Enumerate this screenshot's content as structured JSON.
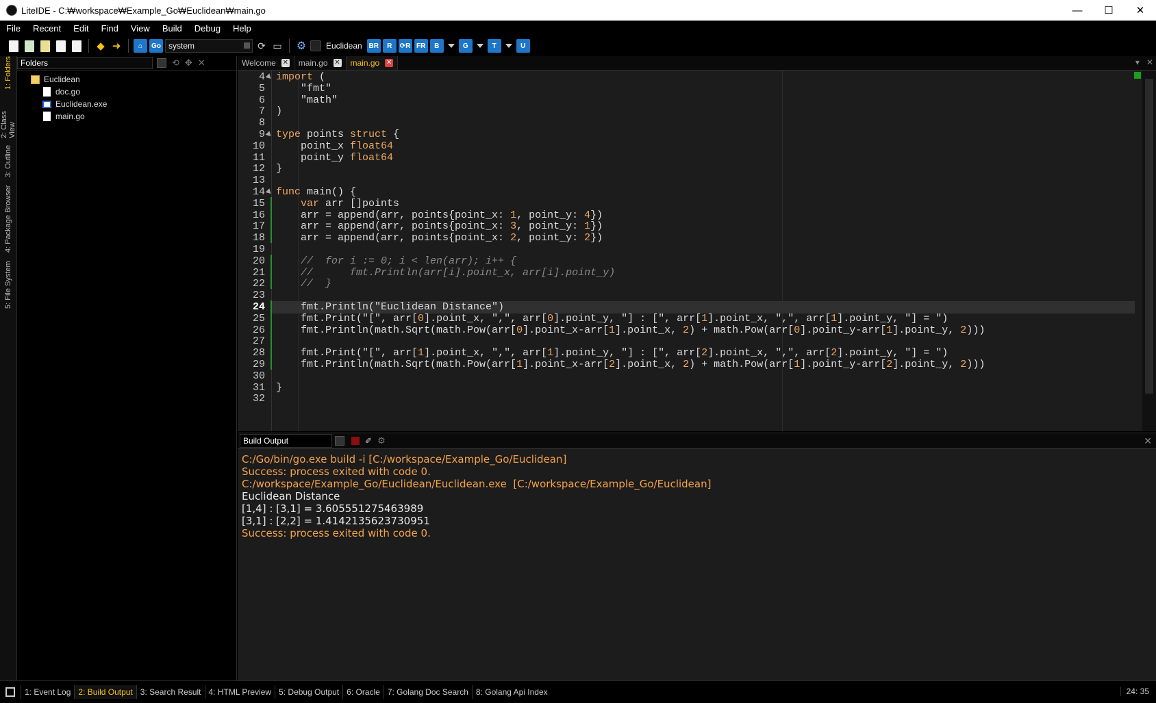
{
  "window": {
    "title": "LiteIDE - C:₩workspace₩Example_Go₩Euclidean₩main.go",
    "minimize": "—",
    "maximize": "☐",
    "close": "✕"
  },
  "menu": [
    "File",
    "Recent",
    "Edit",
    "Find",
    "View",
    "Build",
    "Debug",
    "Help"
  ],
  "toolbar": {
    "environment": "system",
    "project": "Euclidean",
    "build_buttons": [
      "BR",
      "R",
      "⟳R",
      "FR",
      "B",
      "G",
      "T",
      "U"
    ]
  },
  "side_tabs": [
    "1: Folders",
    "2: Class View",
    "3: Outline",
    "4: Package Browser",
    "5: File System"
  ],
  "folders": {
    "title": "Folders",
    "root": "Euclidean",
    "files": [
      {
        "name": "doc.go",
        "type": "file"
      },
      {
        "name": "Euclidean.exe",
        "type": "exe"
      },
      {
        "name": "main.go",
        "type": "file"
      }
    ]
  },
  "editor": {
    "tabs": [
      "Welcome",
      "main.go",
      "main.go"
    ],
    "active_tab": 2,
    "current_line": 24,
    "lines": [
      {
        "n": "4",
        "fold": true,
        "t": "import ("
      },
      {
        "n": "5",
        "t": "    \"fmt\""
      },
      {
        "n": "6",
        "t": "    \"math\""
      },
      {
        "n": "7",
        "t": ")"
      },
      {
        "n": "8",
        "t": ""
      },
      {
        "n": "9",
        "fold": true,
        "t": "type points struct {"
      },
      {
        "n": "10",
        "t": "    point_x float64"
      },
      {
        "n": "11",
        "t": "    point_y float64"
      },
      {
        "n": "12",
        "t": "}"
      },
      {
        "n": "13",
        "t": ""
      },
      {
        "n": "14",
        "fold": true,
        "t": "func main() {"
      },
      {
        "n": "15",
        "t": "    var arr []points"
      },
      {
        "n": "16",
        "t": "    arr = append(arr, points{point_x: 1, point_y: 4})"
      },
      {
        "n": "17",
        "t": "    arr = append(arr, points{point_x: 3, point_y: 1})"
      },
      {
        "n": "18",
        "t": "    arr = append(arr, points{point_x: 2, point_y: 2})"
      },
      {
        "n": "19",
        "t": ""
      },
      {
        "n": "20",
        "t": "    //  for i := 0; i < len(arr); i++ {"
      },
      {
        "n": "21",
        "t": "    //      fmt.Println(arr[i].point_x, arr[i].point_y)"
      },
      {
        "n": "22",
        "t": "    //  }"
      },
      {
        "n": "23",
        "t": ""
      },
      {
        "n": "24",
        "t": "    fmt.Println(\"Euclidean Distance\")"
      },
      {
        "n": "25",
        "t": "    fmt.Print(\"[\", arr[0].point_x, \",\", arr[0].point_y, \"] : [\", arr[1].point_x, \",\", arr[1].point_y, \"] = \")"
      },
      {
        "n": "26",
        "t": "    fmt.Println(math.Sqrt(math.Pow(arr[0].point_x-arr[1].point_x, 2) + math.Pow(arr[0].point_y-arr[1].point_y, 2)))"
      },
      {
        "n": "27",
        "t": ""
      },
      {
        "n": "28",
        "t": "    fmt.Print(\"[\", arr[1].point_x, \",\", arr[1].point_y, \"] : [\", arr[2].point_x, \",\", arr[2].point_y, \"] = \")"
      },
      {
        "n": "29",
        "t": "    fmt.Println(math.Sqrt(math.Pow(arr[1].point_x-arr[2].point_x, 2) + math.Pow(arr[1].point_y-arr[2].point_y, 2)))"
      },
      {
        "n": "30",
        "t": ""
      },
      {
        "n": "31",
        "t": "}"
      },
      {
        "n": "32",
        "t": ""
      }
    ]
  },
  "build_output": {
    "title": "Build Output",
    "lines": [
      {
        "t": "C:/Go/bin/go.exe build -i [C:/workspace/Example_Go/Euclidean]",
        "c": "orange"
      },
      {
        "t": "Success: process exited with code 0.",
        "c": "orange"
      },
      {
        "t": "C:/workspace/Example_Go/Euclidean/Euclidean.exe  [C:/workspace/Example_Go/Euclidean]",
        "c": "orange"
      },
      {
        "t": "Euclidean Distance",
        "c": "white"
      },
      {
        "t": "[1,4] : [3,1] = 3.605551275463989",
        "c": "white"
      },
      {
        "t": "[3,1] : [2,2] = 1.4142135623730951",
        "c": "white"
      },
      {
        "t": "Success: process exited with code 0.",
        "c": "orange"
      }
    ]
  },
  "status_tabs": [
    "1: Event Log",
    "2: Build Output",
    "3: Search Result",
    "4: HTML Preview",
    "5: Debug Output",
    "6: Oracle",
    "7: Golang Doc Search",
    "8: Golang Api Index"
  ],
  "active_status_tab": 1,
  "cursor_position": "24: 35",
  "colors": {
    "accent": "#f5c218",
    "keyword": "#f0a860",
    "output_orange": "#f5a24a",
    "current_line": "#303030"
  }
}
